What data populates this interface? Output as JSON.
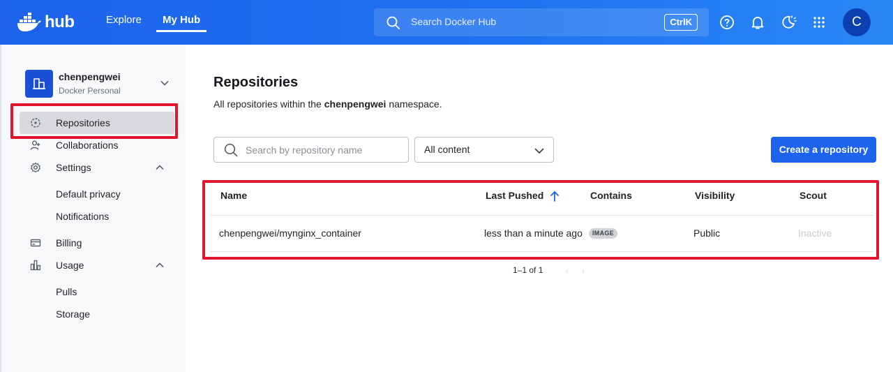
{
  "header": {
    "logo_text": "hub",
    "nav": [
      "Explore",
      "My Hub"
    ],
    "active_nav": "My Hub",
    "search_placeholder": "Search Docker Hub",
    "search_shortcut": "CtrlK",
    "avatar_initial": "C",
    "colors": {
      "brand": "#1d63ed",
      "avatar": "#0c3fb0"
    }
  },
  "sidebar": {
    "org_name": "chenpengwei",
    "org_type": "Docker Personal",
    "items": [
      {
        "label": "Repositories",
        "icon": "repositories-icon",
        "active": true
      },
      {
        "label": "Collaborations",
        "icon": "collaborations-icon"
      },
      {
        "label": "Settings",
        "icon": "gear-icon",
        "expanded": true,
        "children": [
          "Default privacy",
          "Notifications"
        ]
      },
      {
        "label": "Billing",
        "icon": "billing-icon"
      },
      {
        "label": "Usage",
        "icon": "usage-icon",
        "expanded": true,
        "children": [
          "Pulls",
          "Storage"
        ]
      }
    ]
  },
  "main": {
    "title": "Repositories",
    "desc_prefix": "All repositories within the ",
    "desc_namespace": "chenpengwei",
    "desc_suffix": " namespace.",
    "search_placeholder": "Search by repository name",
    "filter_value": "All content",
    "create_label": "Create a repository",
    "table": {
      "columns": [
        "Name",
        "Last Pushed",
        "Contains",
        "Visibility",
        "Scout"
      ],
      "sort_column": "Last Pushed",
      "sort_direction": "ascending",
      "rows": [
        {
          "name": "chenpengwei/mynginx_container",
          "last_pushed": "less than a minute ago",
          "contains": "IMAGE",
          "visibility": "Public",
          "scout": "Inactive"
        }
      ]
    },
    "pagination": "1–1 of 1"
  },
  "annotations": {
    "highlight_color": "#e3142e"
  }
}
